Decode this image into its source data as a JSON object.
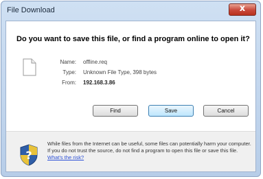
{
  "window": {
    "title": "File Download",
    "close_label": "x"
  },
  "dialog": {
    "question": "Do you want to save this file, or find a program online to open it?",
    "file": {
      "name_label": "Name:",
      "name_value": "offline.req",
      "type_label": "Type:",
      "type_value": "Unknown File Type, 398 bytes",
      "from_label": "From:",
      "from_value": "192.168.3.86"
    },
    "buttons": {
      "find": "Find",
      "save": "Save",
      "cancel": "Cancel"
    },
    "warning_text": "While files from the Internet can be useful, some files can potentially harm your computer. If you do not trust the source, do not find a program to open this file or save this file. ",
    "warning_link": "What's the risk?"
  },
  "colors": {
    "link": "#2b4fd6",
    "close_button": "#c9483a",
    "title_bar": "#cfe0f3"
  },
  "icons": [
    "file-icon",
    "shield-icon",
    "close-icon"
  ]
}
